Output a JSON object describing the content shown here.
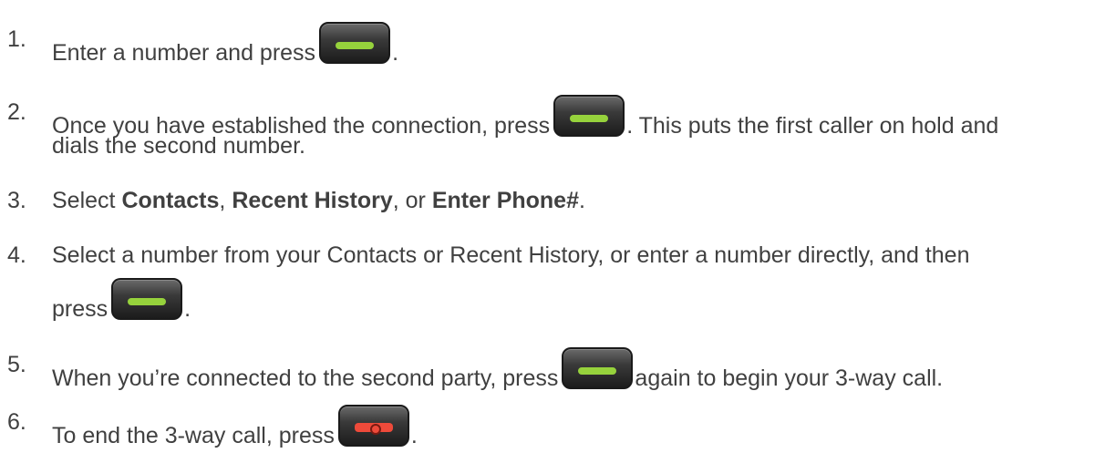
{
  "steps": [
    {
      "num": "1.",
      "t1": "Enter a number and press",
      "t2": "."
    },
    {
      "num": "2.",
      "t1": "Once you have established the connection, press",
      "t2": ". This puts the first caller on hold and",
      "t3": "dials the second number."
    },
    {
      "num": "3.",
      "t1": "Select ",
      "b1": "Contacts",
      "t2": ", ",
      "b2": "Recent History",
      "t3": ", or ",
      "b3": "Enter Phone#",
      "t4": "."
    },
    {
      "num": "4.",
      "t1": "Select a number from your Contacts or Recent History, or enter a number directly, and then",
      "t2": "press",
      "t3": "."
    },
    {
      "num": "5.",
      "t1": "When you’re connected to the second party, press",
      "t2": "again to begin your 3-way call."
    },
    {
      "num": "6.",
      "t1": "To end the 3-way call, press",
      "t2": "."
    }
  ],
  "icons": {
    "talk": "talk-key-icon",
    "end": "end-key-icon"
  },
  "colors": {
    "text": "#404040",
    "talk_key_bar": "#96d23c",
    "end_key_bar": "#ee4a3a"
  }
}
